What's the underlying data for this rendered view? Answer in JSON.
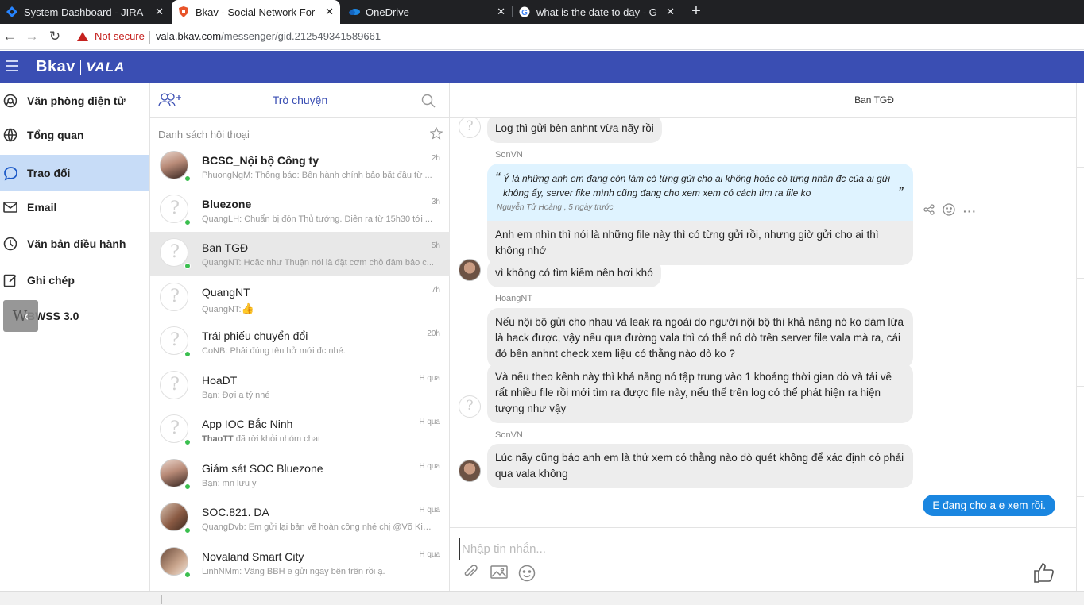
{
  "browser": {
    "tabs": [
      {
        "title": "System Dashboard - JIRA",
        "favicon": "jira-icon"
      },
      {
        "title": "Bkav - Social Network For",
        "favicon": "bkav-shield-icon",
        "active": true
      },
      {
        "title": "OneDrive",
        "favicon": "onedrive-icon"
      },
      {
        "title": "what is the date to day - G",
        "favicon": "google-icon"
      }
    ],
    "security_label": "Not secure",
    "url_host": "vala.bkav.com",
    "url_path": "/messenger/gid.212549341589661"
  },
  "app": {
    "logo_main": "Bkav",
    "logo_sub": "VALA",
    "brand_color": "#3a4eb3"
  },
  "nav": {
    "items": [
      {
        "label": "Văn phòng điện tử",
        "icon": "office-icon"
      },
      {
        "label": "Tổng quan",
        "icon": "globe-icon"
      },
      {
        "label": "Trao đổi",
        "icon": "chat-icon",
        "active": true
      },
      {
        "label": "Email",
        "icon": "mail-icon"
      },
      {
        "label": "Văn bản điều hành",
        "icon": "document-icon"
      },
      {
        "label": "Ghi chép",
        "icon": "note-icon"
      },
      {
        "label": "BWSS 3.0",
        "icon": "bwss-icon"
      }
    ]
  },
  "conversations": {
    "header_title": "Trò chuyện",
    "list_label": "Danh sách hội thoại",
    "items": [
      {
        "name": "BCSC_Nội bộ Công ty",
        "time": "2h",
        "preview": "PhuongNgM: Thông báo: Bên hành chính bảo bắt đầu từ ...",
        "bold": true
      },
      {
        "name": "Bluezone",
        "time": "3h",
        "preview": "QuangLH: Chuẩn bị đón Thủ tướng. Diễn ra từ 15h30 tới ...",
        "bold": true
      },
      {
        "name": "Ban TGĐ",
        "time": "5h",
        "preview": "QuangNT: Hoặc như Thuận nói là đặt cơm chỗ đảm bảo c...",
        "selected": true
      },
      {
        "name": "QuangNT",
        "time": "7h",
        "preview": "QuangNT:"
      },
      {
        "name": "Trái phiếu chuyển đổi",
        "time": "20h",
        "preview": "CoNB: Phải đúng tên hở mới đc nhé."
      },
      {
        "name": "HoaDT",
        "time": "H qua",
        "preview": "Bạn: Đợi a tý nhé"
      },
      {
        "name": "App IOC Bắc Ninh",
        "time": "H qua",
        "preview_bold": "ThaoTT",
        "preview": " đã rời khỏi nhóm chat"
      },
      {
        "name": "Giám sát SOC Bluezone",
        "time": "H qua",
        "preview": "Bạn: mn lưu ý"
      },
      {
        "name": "SOC.821. DA",
        "time": "H qua",
        "preview": "QuangDvb: Em gửi lại bản vẽ hoàn công nhé chị @Võ Kiề..."
      },
      {
        "name": "Novaland Smart City",
        "time": "H qua",
        "preview": "LinhNMm:  Vâng BBH e gửi ngay bên trên rồi ạ."
      }
    ]
  },
  "chat": {
    "title": "Ban TGĐ",
    "messages": {
      "m1": "Log thì gửi bên anhnt vừa nãy rồi",
      "sender1": "SonVN",
      "quote_text": "Ý là những anh em đang còn làm có từng gửi cho ai không hoặc có từng nhận đc của ai gửi không ấy, server fike mình cũng đang cho xem xem có cách tìm ra file ko",
      "quote_source": "Nguyễn Tử Hoàng , 5 ngày trước",
      "m2": "Anh em nhìn thì nói là những file này thì có từng gửi rồi, nhưng giờ gửi cho ai thì không nhớ",
      "m3": "vì không có tìm kiếm nên hơi khó",
      "sender2": "HoangNT",
      "m4": "Nếu nội bộ gửi cho nhau và leak ra ngoài do người nội bộ thì khả năng nó ko dám lừa là hack được, vậy nếu qua đường vala thì có thể nó dò trên server file vala mà ra, cái đó bên anhnt check xem liệu có thằng nào dò ko ?",
      "m5": "Và nếu theo kênh này thì khả năng nó tập trung vào 1 khoảng thời gian dò và tải về rất nhiều file rồi mới tìm ra được file này, nếu thế trên log có thể phát hiện ra hiện tượng như vậy",
      "sender3": "SonVN",
      "m6": "Lúc nãy cũng bảo anh em là thử xem có thằng nào dò quét không để xác định có phải qua vala không",
      "mine": "E đang cho a e xem rồi."
    },
    "composer_placeholder": "Nhập tin nhắn..."
  }
}
